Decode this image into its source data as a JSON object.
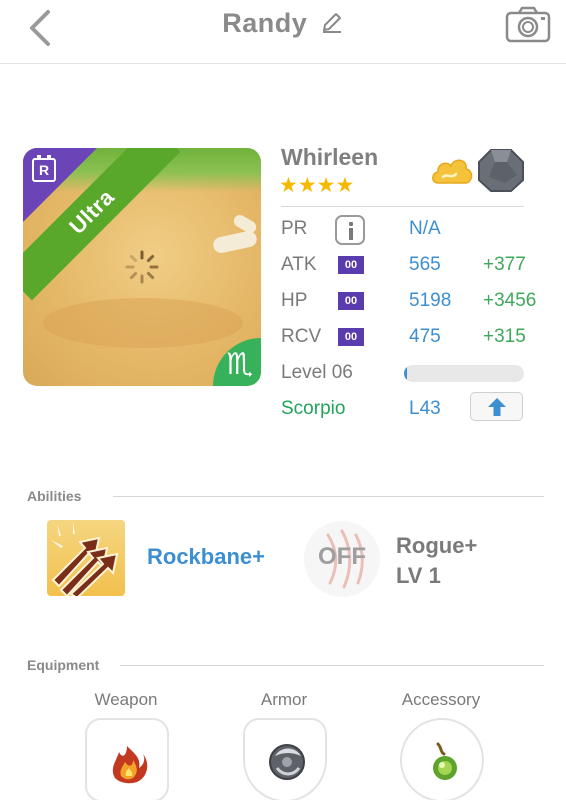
{
  "header": {
    "title": "Randy",
    "back_icon": "chevron-left-icon",
    "edit_icon": "pencil-icon",
    "camera_icon": "camera-icon"
  },
  "card": {
    "rarity_badge": "R",
    "rarity_label": "Ultra",
    "zodiac_glyph": "♏"
  },
  "character": {
    "name": "Whirleen",
    "stars": "★★★★",
    "star_count": 4
  },
  "stats": {
    "pr": {
      "label": "PR",
      "value": "N/A"
    },
    "atk": {
      "label": "ATK",
      "plus": "00",
      "value": "565",
      "bonus": "+377"
    },
    "hp": {
      "label": "HP",
      "plus": "00",
      "value": "5198",
      "bonus": "+3456"
    },
    "rcv": {
      "label": "RCV",
      "plus": "00",
      "value": "475",
      "bonus": "+315"
    },
    "level": {
      "label": "Level 06",
      "exp_fraction": 0.02
    },
    "zodiac": {
      "label": "Scorpio",
      "level_cap": "L43"
    }
  },
  "abilities": {
    "heading": "Abilities",
    "primary": {
      "name": "Rockbane+"
    },
    "secondary": {
      "state": "OFF",
      "name": "Rogue+",
      "level": "LV 1"
    }
  },
  "equipment": {
    "heading": "Equipment",
    "slots": [
      {
        "label": "Weapon"
      },
      {
        "label": "Armor"
      },
      {
        "label": "Accessory"
      }
    ]
  },
  "colors": {
    "accent_blue": "#3d8fd1",
    "bonus_green": "#3fa85a",
    "zodiac_green": "#23a35c",
    "star_gold": "#f6b900",
    "plus_purple": "#5b3cae",
    "ultra_green": "#5aa82a"
  }
}
